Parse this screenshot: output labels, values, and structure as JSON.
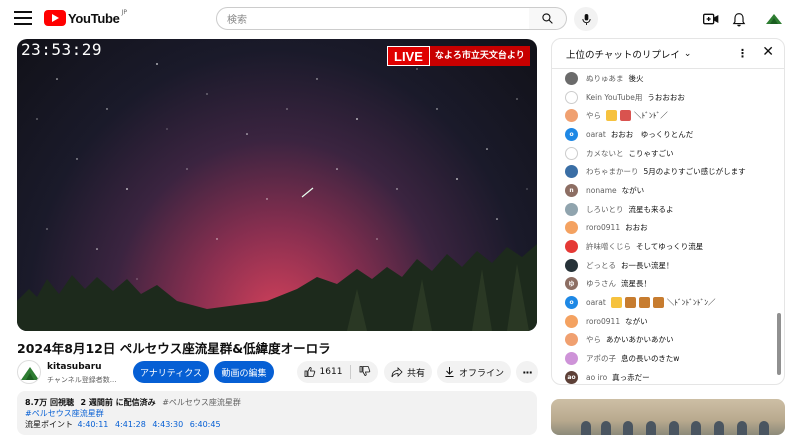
{
  "header": {
    "logo_text": "YouTube",
    "logo_region": "JP",
    "search_placeholder": "検索"
  },
  "player": {
    "timestamp": "23:53:29",
    "live_label": "LIVE",
    "live_source": "なよろ市立天文台より"
  },
  "video": {
    "title": "2024年8月12日 ペルセウス座流星群&低緯度オーロラ",
    "channel_name": "kitasubaru",
    "channel_subs": "チャンネル登録者数...",
    "analytics_label": "アナリティクス",
    "edit_label": "動画の編集",
    "like_count": "1611",
    "share_label": "共有",
    "offline_label": "オフライン"
  },
  "description": {
    "views": "8.7万 回視聴",
    "ago": "2 週間前 に配信済み",
    "hashtag_inline": "#ペルセウス座流星群",
    "hashtag_line": "#ペルセウス座流星群",
    "points_label": "流星ポイント",
    "points": [
      "4:40:11",
      "4:41:28",
      "4:43:30",
      "6:40:45"
    ]
  },
  "chat": {
    "header_title": "上位のチャットのリプレイ",
    "messages": [
      {
        "author": "ぬりゅあま",
        "text": "後火",
        "color": "#6b6b6b",
        "initial": ""
      },
      {
        "author": "Kein YouTube用",
        "text": "うおおおお",
        "color": "#ffffff",
        "initial": ""
      },
      {
        "author": "やら",
        "text": "＼ﾄﾞﾝﾄﾞ／",
        "color": "#f0a070",
        "initial": ""
      },
      {
        "author": "oarat",
        "text": "おおお　ゆっくりとんだ",
        "color": "#1e88e5",
        "initial": "o"
      },
      {
        "author": "カメないと",
        "text": "こりゃすごい",
        "color": "#ffffff",
        "initial": ""
      },
      {
        "author": "わちゃまかーり",
        "text": "5月のよりすごい感じがします",
        "color": "#3a6ea5",
        "initial": ""
      },
      {
        "author": "noname",
        "text": "ながい",
        "color": "#8d6e63",
        "initial": "n"
      },
      {
        "author": "しろいとり",
        "text": "流星も来るよ",
        "color": "#90a4ae",
        "initial": ""
      },
      {
        "author": "roro0911",
        "text": "おおお",
        "color": "#f4a261",
        "initial": ""
      },
      {
        "author": "許味噌くじら",
        "text": "そしてゆっくり流星",
        "color": "#e53935",
        "initial": ""
      },
      {
        "author": "どっとる",
        "text": "お一長い流星！",
        "color": "#263238",
        "initial": ""
      },
      {
        "author": "ゆうさん",
        "text": "流星長！",
        "color": "#8d6e63",
        "initial": "ゆ"
      },
      {
        "author": "oarat",
        "text": "＼ﾄﾞﾝﾄﾞﾝﾄﾞﾝ／",
        "color": "#1e88e5",
        "initial": "o"
      },
      {
        "author": "roro0911",
        "text": "ながい",
        "color": "#f4a261",
        "initial": ""
      },
      {
        "author": "やら",
        "text": "あかいあかいあかい",
        "color": "#f0a070",
        "initial": ""
      },
      {
        "author": "アポの子",
        "text": "息の長いのきたw",
        "color": "#ce93d8",
        "initial": ""
      },
      {
        "author": "ao iro",
        "text": "真っ赤だー",
        "color": "#5d4037",
        "initial": "ao"
      }
    ]
  }
}
